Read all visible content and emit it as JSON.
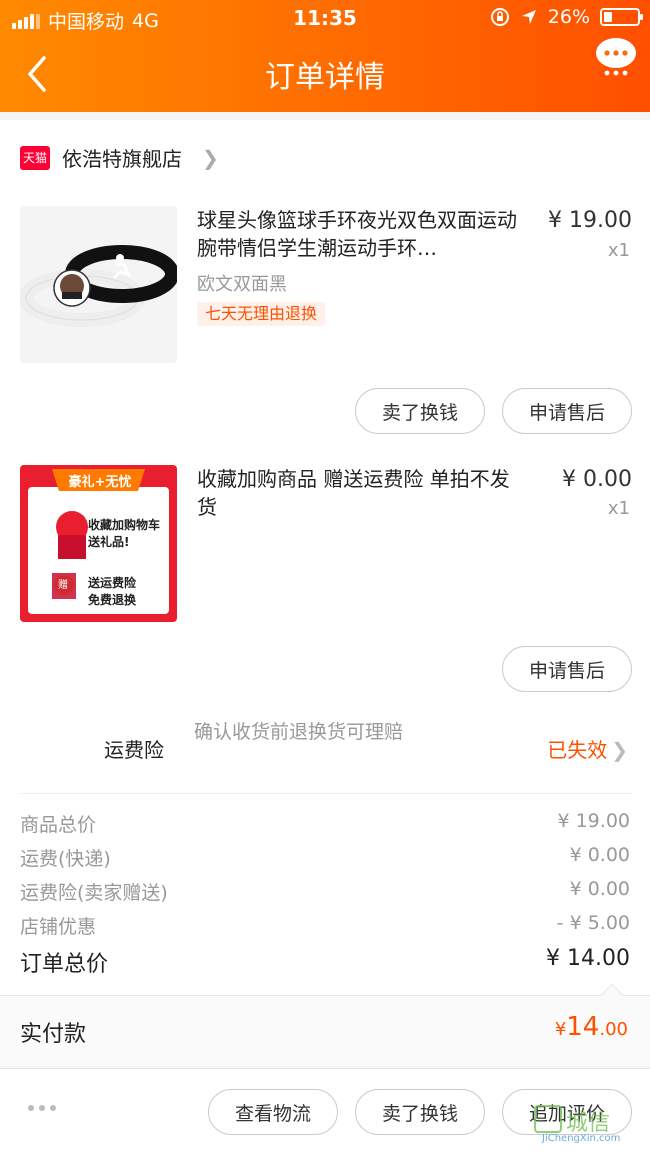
{
  "status_bar": {
    "carrier": "中国移动",
    "network": "4G",
    "time": "11:35",
    "battery_percent": 26
  },
  "nav": {
    "title": "订单详情"
  },
  "shop": {
    "badge": "天猫",
    "name": "依浩特旗舰店"
  },
  "items": [
    {
      "title": "球星头像篮球手环夜光双色双面运动腕带情侣学生潮运动手环…",
      "price": "¥ 19.00",
      "qty": "x1",
      "sku": "欧文双面黑",
      "tag": "七天无理由退换",
      "actions": [
        "卖了换钱",
        "申请售后"
      ]
    },
    {
      "title": "收藏加购商品 赠送运费险 单拍不发货",
      "price": "¥ 0.00",
      "qty": "x1",
      "actions": [
        "申请售后"
      ],
      "image_text": {
        "banner": "豪礼+无忧",
        "line1": "收藏加购物车",
        "line2": "送礼品!",
        "badge": "赠",
        "line3": "送运费险",
        "line4": "免费退换"
      }
    }
  ],
  "insurance": {
    "label": "运费险",
    "desc": "确认收货前退换货可理赔",
    "status": "已失效"
  },
  "summary": [
    {
      "label": "商品总价",
      "value": "¥ 19.00"
    },
    {
      "label": "运费(快递)",
      "value": "¥ 0.00"
    },
    {
      "label": "运费险(卖家赠送)",
      "value": "¥ 0.00"
    },
    {
      "label": "店铺优惠",
      "value": "- ¥ 5.00"
    }
  ],
  "total": {
    "label": "订单总价",
    "value": "¥ 14.00"
  },
  "paid": {
    "label": "实付款",
    "currency": "¥",
    "int": "14",
    "dec": ".00"
  },
  "bottom_actions": [
    "查看物流",
    "卖了换钱",
    "追加评价"
  ],
  "watermark": {
    "cn": "城信",
    "url": "JiChengXin.com"
  },
  "colors": {
    "accent": "#ff5000",
    "header_start": "#ff8a00",
    "header_end": "#ff4f00"
  }
}
